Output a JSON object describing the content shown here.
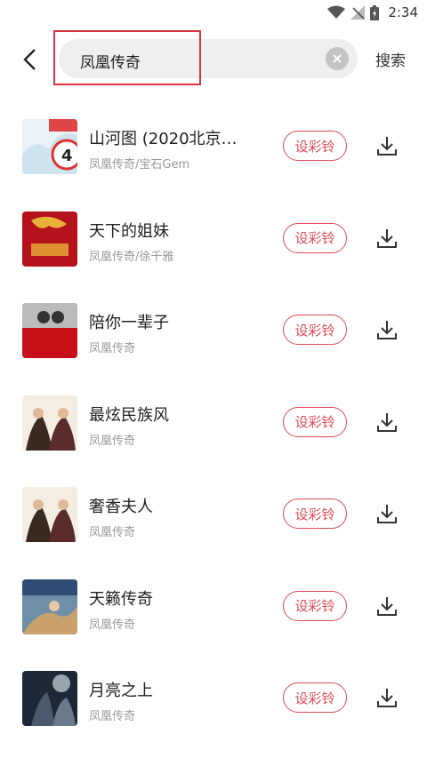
{
  "status_bar": {
    "time": "2:34"
  },
  "search": {
    "query": "凤凰传奇",
    "submit_label": "搜索"
  },
  "songs": [
    {
      "title": "山河图 (2020北京…",
      "subtitle": "凤凰传奇/宝石Gem",
      "ringtone_label": "设彩铃"
    },
    {
      "title": "天下的姐妹",
      "subtitle": "凤凰传奇/徐千雅",
      "ringtone_label": "设彩铃"
    },
    {
      "title": "陪你一辈子",
      "subtitle": "凤凰传奇",
      "ringtone_label": "设彩铃"
    },
    {
      "title": "最炫民族风",
      "subtitle": "凤凰传奇",
      "ringtone_label": "设彩铃"
    },
    {
      "title": "奢香夫人",
      "subtitle": "凤凰传奇",
      "ringtone_label": "设彩铃"
    },
    {
      "title": "天籁传奇",
      "subtitle": "凤凰传奇",
      "ringtone_label": "设彩铃"
    },
    {
      "title": "月亮之上",
      "subtitle": "凤凰传奇",
      "ringtone_label": "设彩铃"
    }
  ],
  "colors": {
    "accent": "#e14b55",
    "highlight": "#d9333f"
  }
}
